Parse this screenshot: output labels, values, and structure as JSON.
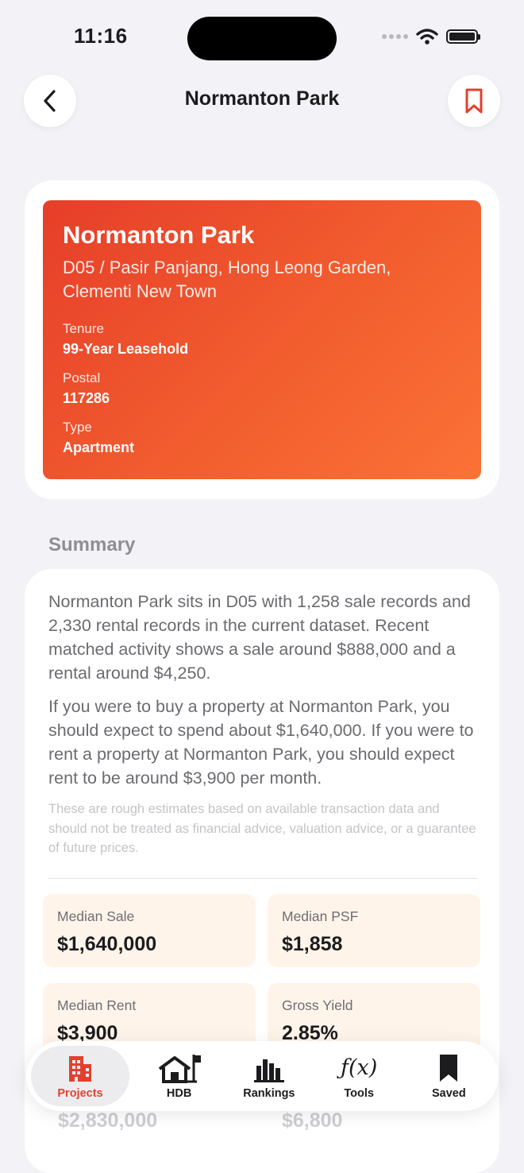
{
  "status": {
    "time": "11:16"
  },
  "nav": {
    "title": "Normanton Park"
  },
  "hero": {
    "name": "Normanton Park",
    "location": "D05 / Pasir Panjang, Hong Leong Garden, Clementi New Town",
    "tenure_label": "Tenure",
    "tenure_value": "99-Year Leasehold",
    "postal_label": "Postal",
    "postal_value": "117286",
    "type_label": "Type",
    "type_value": "Apartment"
  },
  "summary": {
    "heading": "Summary",
    "paragraph1": "Normanton Park sits in D05 with 1,258 sale records and 2,330 rental records in the current dataset. Recent matched activity shows a sale around $888,000 and a rental around $4,250.",
    "paragraph2": "If you were to buy a property at Normanton Park, you should expect to spend about $1,640,000. If you were to rent a property at Normanton Park, you should expect rent to be around $3,900 per month.",
    "disclaimer": "These are rough estimates based on available transaction data and should not be treated as financial advice, valuation advice, or a guarantee of future prices."
  },
  "metrics": [
    {
      "label": "Median Sale",
      "value": "$1,640,000"
    },
    {
      "label": "Median PSF",
      "value": "$1,858"
    },
    {
      "label": "Median Rent",
      "value": "$3,900"
    },
    {
      "label": "Gross Yield",
      "value": "2.85%"
    }
  ],
  "partial_values": [
    "$2,830,000",
    "$6,800"
  ],
  "tabs": [
    {
      "label": "Projects",
      "icon": "building-icon",
      "active": true
    },
    {
      "label": "HDB",
      "icon": "house-flag-icon",
      "active": false
    },
    {
      "label": "Rankings",
      "icon": "bar-chart-icon",
      "active": false
    },
    {
      "label": "Tools",
      "icon": "function-icon",
      "active": false
    },
    {
      "label": "Saved",
      "icon": "bookmark-icon",
      "active": false
    }
  ],
  "colors": {
    "accent": "#e2402f",
    "hero_start": "#e63e2a",
    "hero_end": "#fb7236",
    "metric_bg": "#fff4ea"
  }
}
